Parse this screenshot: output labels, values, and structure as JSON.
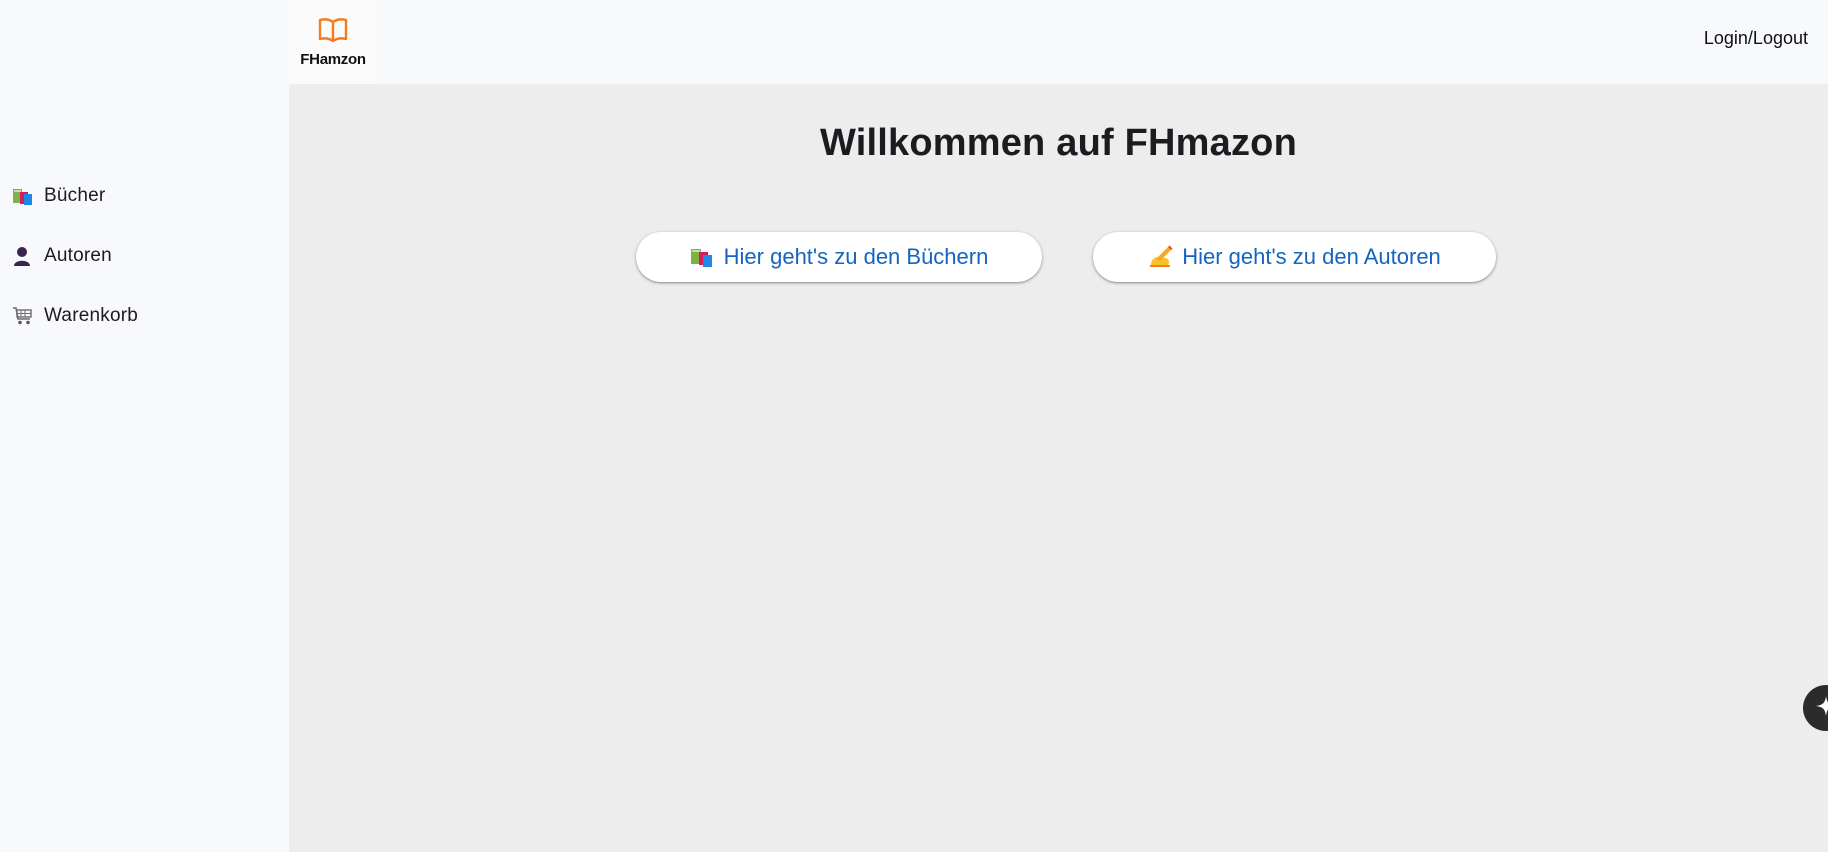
{
  "header": {
    "logo_text": "FHamzon",
    "login_label": "Login/Logout"
  },
  "sidebar": {
    "items": [
      {
        "label": "Bücher",
        "icon": "books-icon"
      },
      {
        "label": "Autoren",
        "icon": "person-icon"
      },
      {
        "label": "Warenkorb",
        "icon": "shopping-cart-icon"
      }
    ]
  },
  "main": {
    "title": "Willkommen auf FHmazon",
    "buttons": [
      {
        "label": "Hier geht's zu den Büchern",
        "icon": "books-icon"
      },
      {
        "label": "Hier geht's zu den Autoren",
        "icon": "writing-hand-icon"
      }
    ]
  },
  "fab": {
    "icon": "sparkle-icon"
  },
  "colors": {
    "accent": "#1565c0",
    "logo_orange": "#f47b20",
    "main_bg": "#ededed",
    "sidebar_bg": "#f8f9fd"
  }
}
